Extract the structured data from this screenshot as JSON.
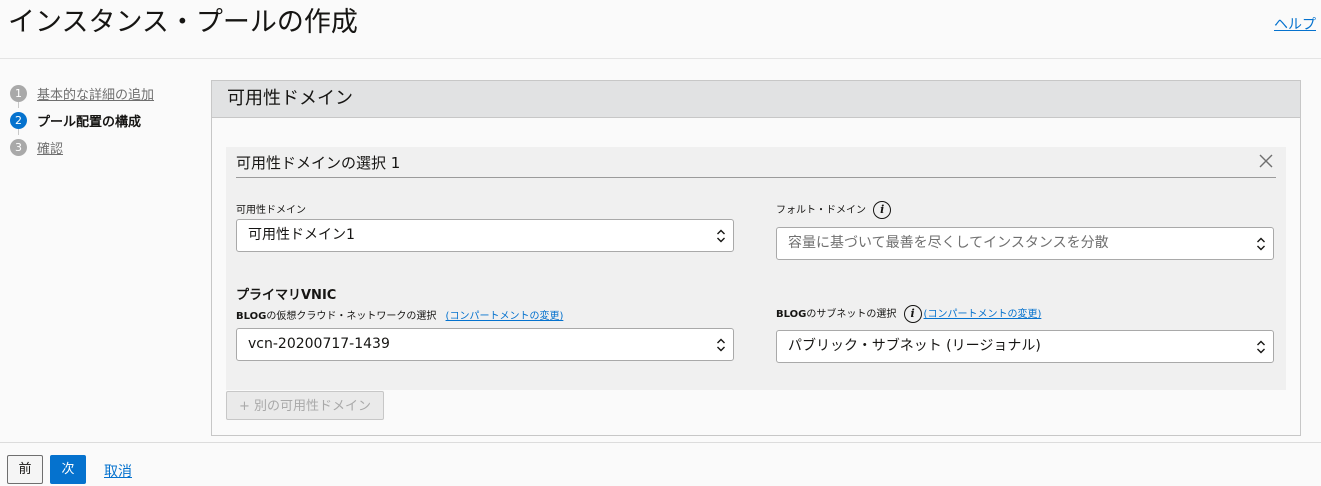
{
  "header": {
    "title": "インスタンス・プールの作成",
    "help_label": "ヘルプ"
  },
  "steps": [
    {
      "num": "1",
      "label": "基本的な詳細の追加"
    },
    {
      "num": "2",
      "label": "プール配置の構成"
    },
    {
      "num": "3",
      "label": "確認"
    }
  ],
  "panel": {
    "title": "可用性ドメイン",
    "card": {
      "title": "可用性ドメインの選択 1",
      "availability_domain": {
        "label": "可用性ドメイン",
        "value": "可用性ドメイン1"
      },
      "fault_domain": {
        "label": "フォルト・ドメイン",
        "placeholder": "容量に基づいて最善を尽くしてインスタンスを分散"
      },
      "primary_vnic_title": "プライマリVNIC",
      "vcn": {
        "label_prefix": "BLOG",
        "label_rest": "の仮想クラウド・ネットワークの選択",
        "change_link": "(コンパートメントの変更)",
        "value": "vcn-20200717-1439"
      },
      "subnet": {
        "label_prefix": "BLOG",
        "label_rest": "のサブネットの選択",
        "change_link": "(コンパートメントの変更)",
        "value": "パブリック・サブネット (リージョナル)"
      }
    },
    "add_button": "+ 別の可用性ドメイン"
  },
  "footer": {
    "prev_label": "前",
    "next_label": "次",
    "cancel_label": "取消"
  }
}
